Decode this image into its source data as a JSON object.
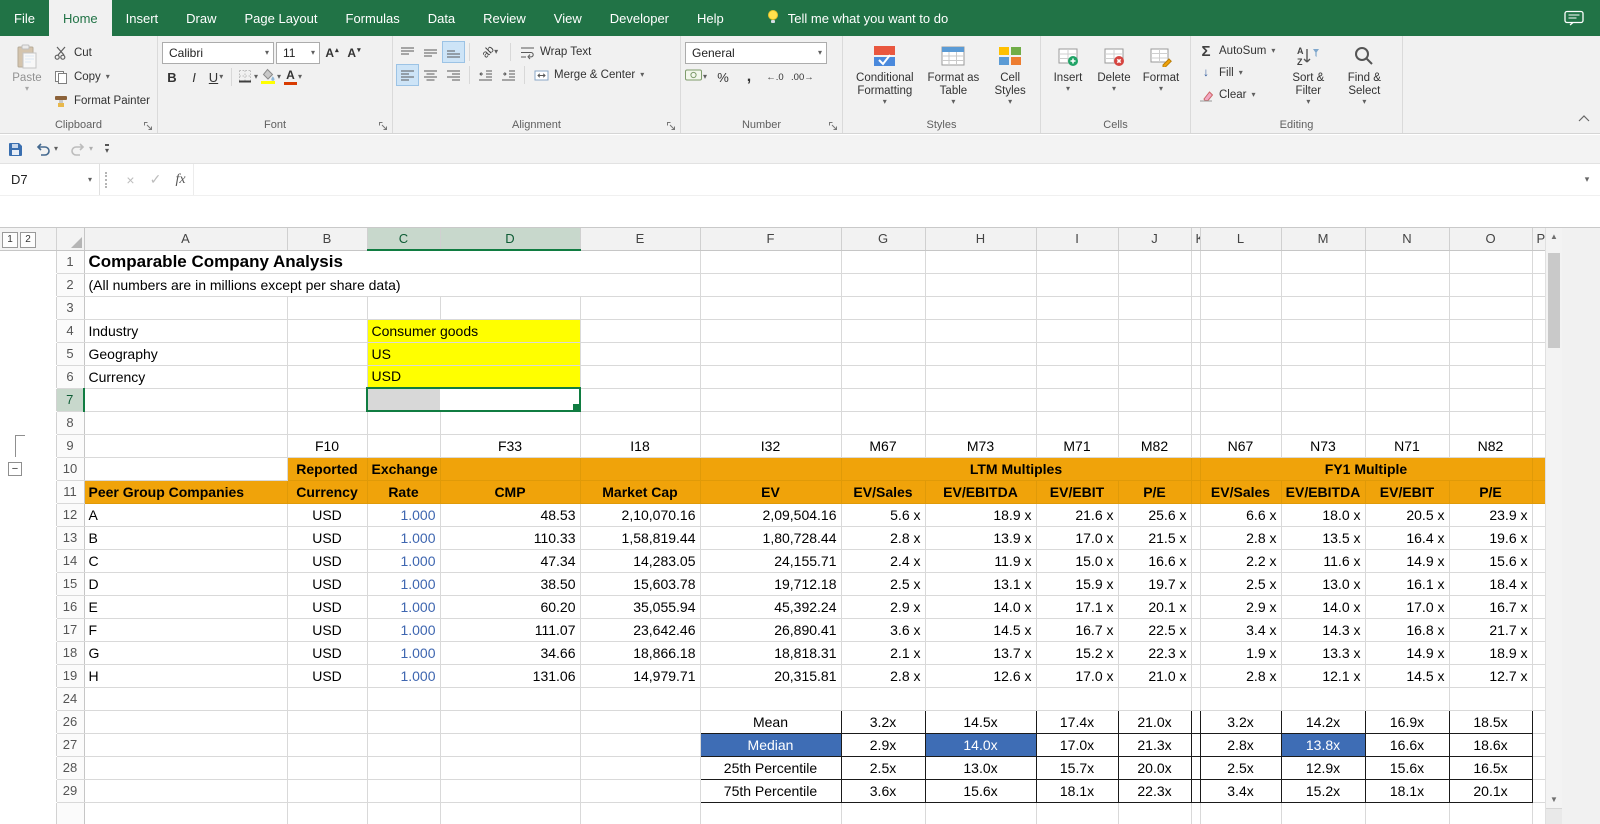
{
  "ribbon": {
    "tabs": [
      "File",
      "Home",
      "Insert",
      "Draw",
      "Page Layout",
      "Formulas",
      "Data",
      "Review",
      "View",
      "Developer",
      "Help"
    ],
    "active_tab": "Home",
    "tell_me": "Tell me what you want to do",
    "clipboard": {
      "label": "Clipboard",
      "paste": "Paste",
      "cut": "Cut",
      "copy": "Copy",
      "format_painter": "Format Painter"
    },
    "font": {
      "label": "Font",
      "font_name": "Calibri",
      "font_size": "11"
    },
    "alignment": {
      "label": "Alignment",
      "wrap_text": "Wrap Text",
      "merge_center": "Merge & Center"
    },
    "number": {
      "label": "Number",
      "format": "General"
    },
    "styles": {
      "label": "Styles",
      "conditional": "Conditional Formatting",
      "format_table": "Format as Table",
      "cell_styles": "Cell Styles"
    },
    "cells": {
      "label": "Cells",
      "insert": "Insert",
      "delete": "Delete",
      "format": "Format"
    },
    "editing": {
      "label": "Editing",
      "autosum": "AutoSum",
      "fill": "Fill",
      "clear": "Clear",
      "sort_filter": "Sort & Filter",
      "find_select": "Find & Select"
    }
  },
  "formula_bar": {
    "name_box": "D7",
    "formula": ""
  },
  "sheet": {
    "outline_levels": [
      "1",
      "2"
    ],
    "outline_collapse": "−",
    "columns": [
      "A",
      "B",
      "C",
      "D",
      "E",
      "F",
      "G",
      "H",
      "I",
      "J",
      "K",
      "L",
      "M",
      "N",
      "O",
      "P"
    ],
    "selected_columns": [
      "C",
      "D"
    ],
    "selected_row": "7",
    "rows": [
      {
        "n": "1",
        "cells": {
          "A": {
            "t": "Comparable Company Analysis",
            "k": "title",
            "sp": 5
          }
        }
      },
      {
        "n": "2",
        "cells": {
          "A": {
            "t": "(All numbers are in millions except per share data)",
            "k": "sub",
            "sp": 5
          }
        }
      },
      {
        "n": "3",
        "cells": {}
      },
      {
        "n": "4",
        "cells": {
          "A": {
            "t": "Industry",
            "k": "lbl"
          },
          "C": {
            "t": "Consumer goods",
            "k": "yel",
            "sp": 2
          }
        }
      },
      {
        "n": "5",
        "cells": {
          "A": {
            "t": "Geography",
            "k": "lbl"
          },
          "C": {
            "t": "US",
            "k": "yel",
            "sp": 2
          }
        }
      },
      {
        "n": "6",
        "cells": {
          "A": {
            "t": "Currency",
            "k": "lbl"
          },
          "C": {
            "t": "USD",
            "k": "yel",
            "sp": 2
          }
        }
      },
      {
        "n": "7",
        "cells": {
          "C": {
            "t": "",
            "k": "selc"
          },
          "D": {
            "t": "",
            "k": "seld"
          }
        }
      },
      {
        "n": "8",
        "cells": {}
      },
      {
        "n": "9",
        "cells": {
          "B": {
            "t": "F10",
            "k": "ref"
          },
          "D": {
            "t": "F33",
            "k": "ref"
          },
          "E": {
            "t": "I18",
            "k": "ref"
          },
          "F": {
            "t": "I32",
            "k": "ref"
          },
          "G": {
            "t": "M67",
            "k": "ref"
          },
          "H": {
            "t": "M73",
            "k": "ref"
          },
          "I": {
            "t": "M71",
            "k": "ref"
          },
          "J": {
            "t": "M82",
            "k": "ref"
          },
          "L": {
            "t": "N67",
            "k": "ref"
          },
          "M": {
            "t": "N73",
            "k": "ref"
          },
          "N": {
            "t": "N71",
            "k": "ref"
          },
          "O": {
            "t": "N82",
            "k": "ref"
          }
        }
      },
      {
        "n": "10",
        "cells": {
          "B": {
            "t": "Reported",
            "k": "band"
          },
          "C": {
            "t": "Exchange",
            "k": "band"
          },
          "D": {
            "t": "",
            "k": "band"
          },
          "E": {
            "t": "",
            "k": "band"
          },
          "F": {
            "t": "",
            "k": "band"
          },
          "G": {
            "t": "LTM Multiples",
            "k": "band",
            "sp": 4
          },
          "K": {
            "t": "",
            "k": "band"
          },
          "L": {
            "t": "FY1 Multiple",
            "k": "band",
            "sp": 4
          },
          "P": {
            "t": "",
            "k": "band"
          }
        }
      },
      {
        "n": "11",
        "cells": {
          "A": {
            "t": "Peer Group Companies",
            "k": "bandl"
          },
          "B": {
            "t": "Currency",
            "k": "band"
          },
          "C": {
            "t": "Rate",
            "k": "band"
          },
          "D": {
            "t": "CMP",
            "k": "band"
          },
          "E": {
            "t": "Market Cap",
            "k": "band"
          },
          "F": {
            "t": "EV",
            "k": "band"
          },
          "G": {
            "t": "EV/Sales",
            "k": "band"
          },
          "H": {
            "t": "EV/EBITDA",
            "k": "band"
          },
          "I": {
            "t": "EV/EBIT",
            "k": "band"
          },
          "J": {
            "t": "P/E",
            "k": "band"
          },
          "K": {
            "t": "",
            "k": "band"
          },
          "L": {
            "t": "EV/Sales",
            "k": "band"
          },
          "M": {
            "t": "EV/EBITDA",
            "k": "band"
          },
          "N": {
            "t": "EV/EBIT",
            "k": "band"
          },
          "O": {
            "t": "P/E",
            "k": "band"
          },
          "P": {
            "t": "",
            "k": "band"
          }
        }
      },
      {
        "n": "12",
        "cells": {
          "A": {
            "t": "A",
            "k": "al"
          },
          "B": {
            "t": "USD",
            "k": "cc"
          },
          "C": {
            "t": "1.000",
            "k": "br"
          },
          "D": {
            "t": "48.53",
            "k": "nr"
          },
          "E": {
            "t": "2,10,070.16",
            "k": "nr"
          },
          "F": {
            "t": "2,09,504.16",
            "k": "nr"
          },
          "G": {
            "t": "5.6 x",
            "k": "mx"
          },
          "H": {
            "t": "18.9 x",
            "k": "mx"
          },
          "I": {
            "t": "21.6 x",
            "k": "mx"
          },
          "J": {
            "t": "25.6 x",
            "k": "mx"
          },
          "L": {
            "t": "6.6 x",
            "k": "mx"
          },
          "M": {
            "t": "18.0 x",
            "k": "mx"
          },
          "N": {
            "t": "20.5 x",
            "k": "mx"
          },
          "O": {
            "t": "23.9 x",
            "k": "mx"
          }
        }
      },
      {
        "n": "13",
        "cells": {
          "A": {
            "t": "B",
            "k": "al"
          },
          "B": {
            "t": "USD",
            "k": "cc"
          },
          "C": {
            "t": "1.000",
            "k": "br"
          },
          "D": {
            "t": "110.33",
            "k": "nr"
          },
          "E": {
            "t": "1,58,819.44",
            "k": "nr"
          },
          "F": {
            "t": "1,80,728.44",
            "k": "nr"
          },
          "G": {
            "t": "2.8 x",
            "k": "mx"
          },
          "H": {
            "t": "13.9 x",
            "k": "mx"
          },
          "I": {
            "t": "17.0 x",
            "k": "mx"
          },
          "J": {
            "t": "21.5 x",
            "k": "mx"
          },
          "L": {
            "t": "2.8 x",
            "k": "mx"
          },
          "M": {
            "t": "13.5 x",
            "k": "mx"
          },
          "N": {
            "t": "16.4 x",
            "k": "mx"
          },
          "O": {
            "t": "19.6 x",
            "k": "mx"
          }
        }
      },
      {
        "n": "14",
        "cells": {
          "A": {
            "t": "C",
            "k": "al"
          },
          "B": {
            "t": "USD",
            "k": "cc"
          },
          "C": {
            "t": "1.000",
            "k": "br"
          },
          "D": {
            "t": "47.34",
            "k": "nr"
          },
          "E": {
            "t": "14,283.05",
            "k": "nr"
          },
          "F": {
            "t": "24,155.71",
            "k": "nr"
          },
          "G": {
            "t": "2.4 x",
            "k": "mx"
          },
          "H": {
            "t": "11.9 x",
            "k": "mx"
          },
          "I": {
            "t": "15.0 x",
            "k": "mx"
          },
          "J": {
            "t": "16.6 x",
            "k": "mx"
          },
          "L": {
            "t": "2.2 x",
            "k": "mx"
          },
          "M": {
            "t": "11.6 x",
            "k": "mx"
          },
          "N": {
            "t": "14.9 x",
            "k": "mx"
          },
          "O": {
            "t": "15.6 x",
            "k": "mx"
          }
        }
      },
      {
        "n": "15",
        "cells": {
          "A": {
            "t": "D",
            "k": "al"
          },
          "B": {
            "t": "USD",
            "k": "cc"
          },
          "C": {
            "t": "1.000",
            "k": "br"
          },
          "D": {
            "t": "38.50",
            "k": "nr"
          },
          "E": {
            "t": "15,603.78",
            "k": "nr"
          },
          "F": {
            "t": "19,712.18",
            "k": "nr"
          },
          "G": {
            "t": "2.5 x",
            "k": "mx"
          },
          "H": {
            "t": "13.1 x",
            "k": "mx"
          },
          "I": {
            "t": "15.9 x",
            "k": "mx"
          },
          "J": {
            "t": "19.7 x",
            "k": "mx"
          },
          "L": {
            "t": "2.5 x",
            "k": "mx"
          },
          "M": {
            "t": "13.0 x",
            "k": "mx"
          },
          "N": {
            "t": "16.1 x",
            "k": "mx"
          },
          "O": {
            "t": "18.4 x",
            "k": "mx"
          }
        }
      },
      {
        "n": "16",
        "cells": {
          "A": {
            "t": "E",
            "k": "al"
          },
          "B": {
            "t": "USD",
            "k": "cc"
          },
          "C": {
            "t": "1.000",
            "k": "br"
          },
          "D": {
            "t": "60.20",
            "k": "nr"
          },
          "E": {
            "t": "35,055.94",
            "k": "nr"
          },
          "F": {
            "t": "45,392.24",
            "k": "nr"
          },
          "G": {
            "t": "2.9 x",
            "k": "mx"
          },
          "H": {
            "t": "14.0 x",
            "k": "mx"
          },
          "I": {
            "t": "17.1 x",
            "k": "mx"
          },
          "J": {
            "t": "20.1 x",
            "k": "mx"
          },
          "L": {
            "t": "2.9 x",
            "k": "mx"
          },
          "M": {
            "t": "14.0 x",
            "k": "mx"
          },
          "N": {
            "t": "17.0 x",
            "k": "mx"
          },
          "O": {
            "t": "16.7 x",
            "k": "mx"
          }
        }
      },
      {
        "n": "17",
        "cells": {
          "A": {
            "t": "F",
            "k": "al"
          },
          "B": {
            "t": "USD",
            "k": "cc"
          },
          "C": {
            "t": "1.000",
            "k": "br"
          },
          "D": {
            "t": "111.07",
            "k": "nr"
          },
          "E": {
            "t": "23,642.46",
            "k": "nr"
          },
          "F": {
            "t": "26,890.41",
            "k": "nr"
          },
          "G": {
            "t": "3.6 x",
            "k": "mx"
          },
          "H": {
            "t": "14.5 x",
            "k": "mx"
          },
          "I": {
            "t": "16.7 x",
            "k": "mx"
          },
          "J": {
            "t": "22.5 x",
            "k": "mx"
          },
          "L": {
            "t": "3.4 x",
            "k": "mx"
          },
          "M": {
            "t": "14.3 x",
            "k": "mx"
          },
          "N": {
            "t": "16.8 x",
            "k": "mx"
          },
          "O": {
            "t": "21.7 x",
            "k": "mx"
          }
        }
      },
      {
        "n": "18",
        "cells": {
          "A": {
            "t": "G",
            "k": "al"
          },
          "B": {
            "t": "USD",
            "k": "cc"
          },
          "C": {
            "t": "1.000",
            "k": "br"
          },
          "D": {
            "t": "34.66",
            "k": "nr"
          },
          "E": {
            "t": "18,866.18",
            "k": "nr"
          },
          "F": {
            "t": "18,818.31",
            "k": "nr"
          },
          "G": {
            "t": "2.1 x",
            "k": "mx"
          },
          "H": {
            "t": "13.7 x",
            "k": "mx"
          },
          "I": {
            "t": "15.2 x",
            "k": "mx"
          },
          "J": {
            "t": "22.3 x",
            "k": "mx"
          },
          "L": {
            "t": "1.9 x",
            "k": "mx"
          },
          "M": {
            "t": "13.3 x",
            "k": "mx"
          },
          "N": {
            "t": "14.9 x",
            "k": "mx"
          },
          "O": {
            "t": "18.9 x",
            "k": "mx"
          }
        }
      },
      {
        "n": "19",
        "cells": {
          "A": {
            "t": "H",
            "k": "al"
          },
          "B": {
            "t": "USD",
            "k": "cc"
          },
          "C": {
            "t": "1.000",
            "k": "br"
          },
          "D": {
            "t": "131.06",
            "k": "nr"
          },
          "E": {
            "t": "14,979.71",
            "k": "nr"
          },
          "F": {
            "t": "20,315.81",
            "k": "nr"
          },
          "G": {
            "t": "2.8 x",
            "k": "mx"
          },
          "H": {
            "t": "12.6 x",
            "k": "mx"
          },
          "I": {
            "t": "17.0 x",
            "k": "mx"
          },
          "J": {
            "t": "21.0 x",
            "k": "mx"
          },
          "L": {
            "t": "2.8 x",
            "k": "mx"
          },
          "M": {
            "t": "12.1 x",
            "k": "mx"
          },
          "N": {
            "t": "14.5 x",
            "k": "mx"
          },
          "O": {
            "t": "12.7 x",
            "k": "mx"
          }
        }
      },
      {
        "n": "24",
        "cells": {}
      },
      {
        "n": "26",
        "cells": {
          "F": {
            "t": "Mean",
            "k": "st"
          },
          "G": {
            "t": "3.2x",
            "k": "st"
          },
          "H": {
            "t": "14.5x",
            "k": "st"
          },
          "I": {
            "t": "17.4x",
            "k": "st"
          },
          "J": {
            "t": "21.0x",
            "k": "st"
          },
          "K": {
            "t": "",
            "k": "st"
          },
          "L": {
            "t": "3.2x",
            "k": "st"
          },
          "M": {
            "t": "14.2x",
            "k": "st"
          },
          "N": {
            "t": "16.9x",
            "k": "st"
          },
          "O": {
            "t": "18.5x",
            "k": "st"
          }
        }
      },
      {
        "n": "27",
        "cells": {
          "F": {
            "t": "Median",
            "k": "stb"
          },
          "G": {
            "t": "2.9x",
            "k": "st"
          },
          "H": {
            "t": "14.0x",
            "k": "stb"
          },
          "I": {
            "t": "17.0x",
            "k": "st"
          },
          "J": {
            "t": "21.3x",
            "k": "st"
          },
          "K": {
            "t": "",
            "k": "st"
          },
          "L": {
            "t": "2.8x",
            "k": "st"
          },
          "M": {
            "t": "13.8x",
            "k": "stb"
          },
          "N": {
            "t": "16.6x",
            "k": "st"
          },
          "O": {
            "t": "18.6x",
            "k": "st"
          }
        }
      },
      {
        "n": "28",
        "cells": {
          "F": {
            "t": "25th Percentile",
            "k": "st"
          },
          "G": {
            "t": "2.5x",
            "k": "st"
          },
          "H": {
            "t": "13.0x",
            "k": "st"
          },
          "I": {
            "t": "15.7x",
            "k": "st"
          },
          "J": {
            "t": "20.0x",
            "k": "st"
          },
          "K": {
            "t": "",
            "k": "st"
          },
          "L": {
            "t": "2.5x",
            "k": "st"
          },
          "M": {
            "t": "12.9x",
            "k": "st"
          },
          "N": {
            "t": "15.6x",
            "k": "st"
          },
          "O": {
            "t": "16.5x",
            "k": "st"
          }
        }
      },
      {
        "n": "29",
        "cells": {
          "F": {
            "t": "75th Percentile",
            "k": "st"
          },
          "G": {
            "t": "3.6x",
            "k": "st"
          },
          "H": {
            "t": "15.6x",
            "k": "st"
          },
          "I": {
            "t": "18.1x",
            "k": "st"
          },
          "J": {
            "t": "22.3x",
            "k": "st"
          },
          "K": {
            "t": "",
            "k": "st"
          },
          "L": {
            "t": "3.4x",
            "k": "st"
          },
          "M": {
            "t": "15.2x",
            "k": "st"
          },
          "N": {
            "t": "18.1x",
            "k": "st"
          },
          "O": {
            "t": "20.1x",
            "k": "st"
          }
        }
      },
      {
        "n": "",
        "cells": {}
      }
    ]
  },
  "colors": {
    "excel_green": "#217346",
    "selection_green": "#107C41",
    "band": "#F0A30A",
    "yellow": "#FFFF00",
    "median_blue": "#3E6DB5",
    "input_blue": "#3E66B0"
  }
}
